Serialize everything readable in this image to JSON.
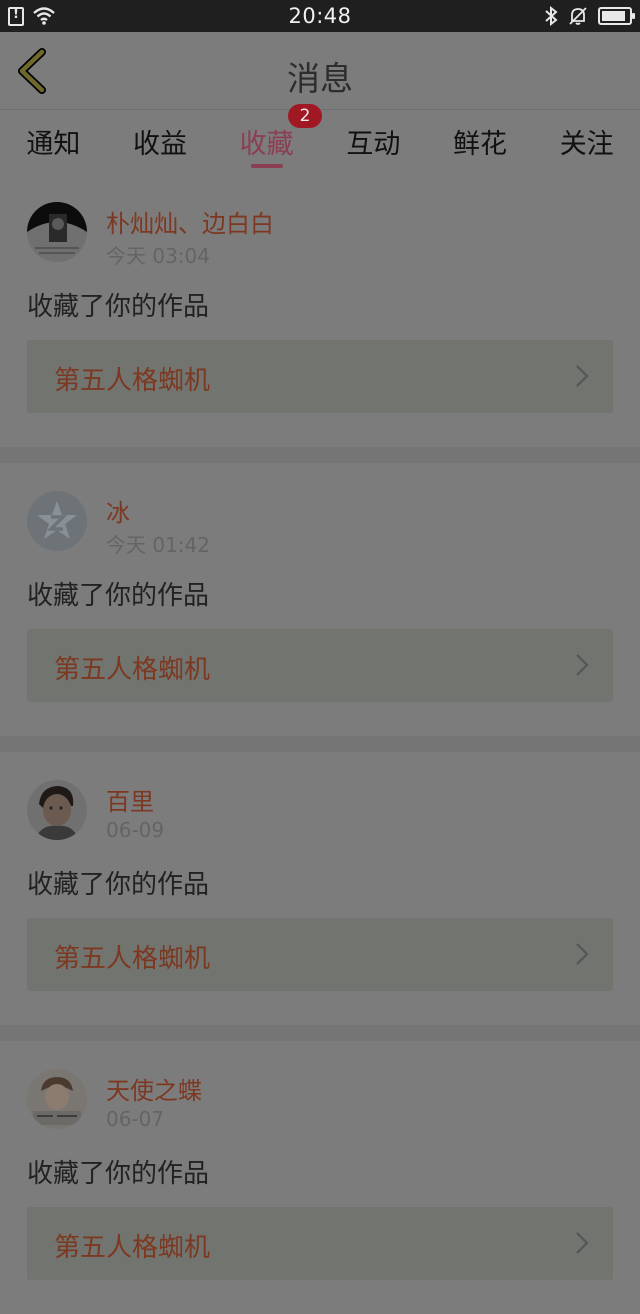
{
  "status_bar": {
    "time": "20:48",
    "battery_level": 0.9,
    "icons": [
      "sim-alert-icon",
      "wifi-icon",
      "bluetooth-icon",
      "mute-bell-icon",
      "battery-icon"
    ]
  },
  "header": {
    "title": "消息",
    "back_icon": "chevron-left-icon"
  },
  "tabs": [
    {
      "label": "通知"
    },
    {
      "label": "收益"
    },
    {
      "label": "收藏",
      "active": true,
      "badge": "2"
    },
    {
      "label": "互动"
    },
    {
      "label": "鲜花"
    },
    {
      "label": "关注"
    }
  ],
  "items": [
    {
      "user": "朴灿灿、边白白",
      "time": "今天 03:04",
      "action": "收藏了你的作品",
      "work": "第五人格蜘机"
    },
    {
      "user": "冰",
      "time": "今天 01:42",
      "action": "收藏了你的作品",
      "work": "第五人格蜘机"
    },
    {
      "user": "百里",
      "time": "06-09",
      "action": "收藏了你的作品",
      "work": "第五人格蜘机"
    },
    {
      "user": "天使之蝶",
      "time": "06-07",
      "action": "收藏了你的作品",
      "work": "第五人格蜘机"
    }
  ],
  "colors": {
    "accent": "#8c3e52",
    "badge": "#a01824",
    "username": "#7c3820",
    "overlay_background": "#7c7c7c"
  }
}
